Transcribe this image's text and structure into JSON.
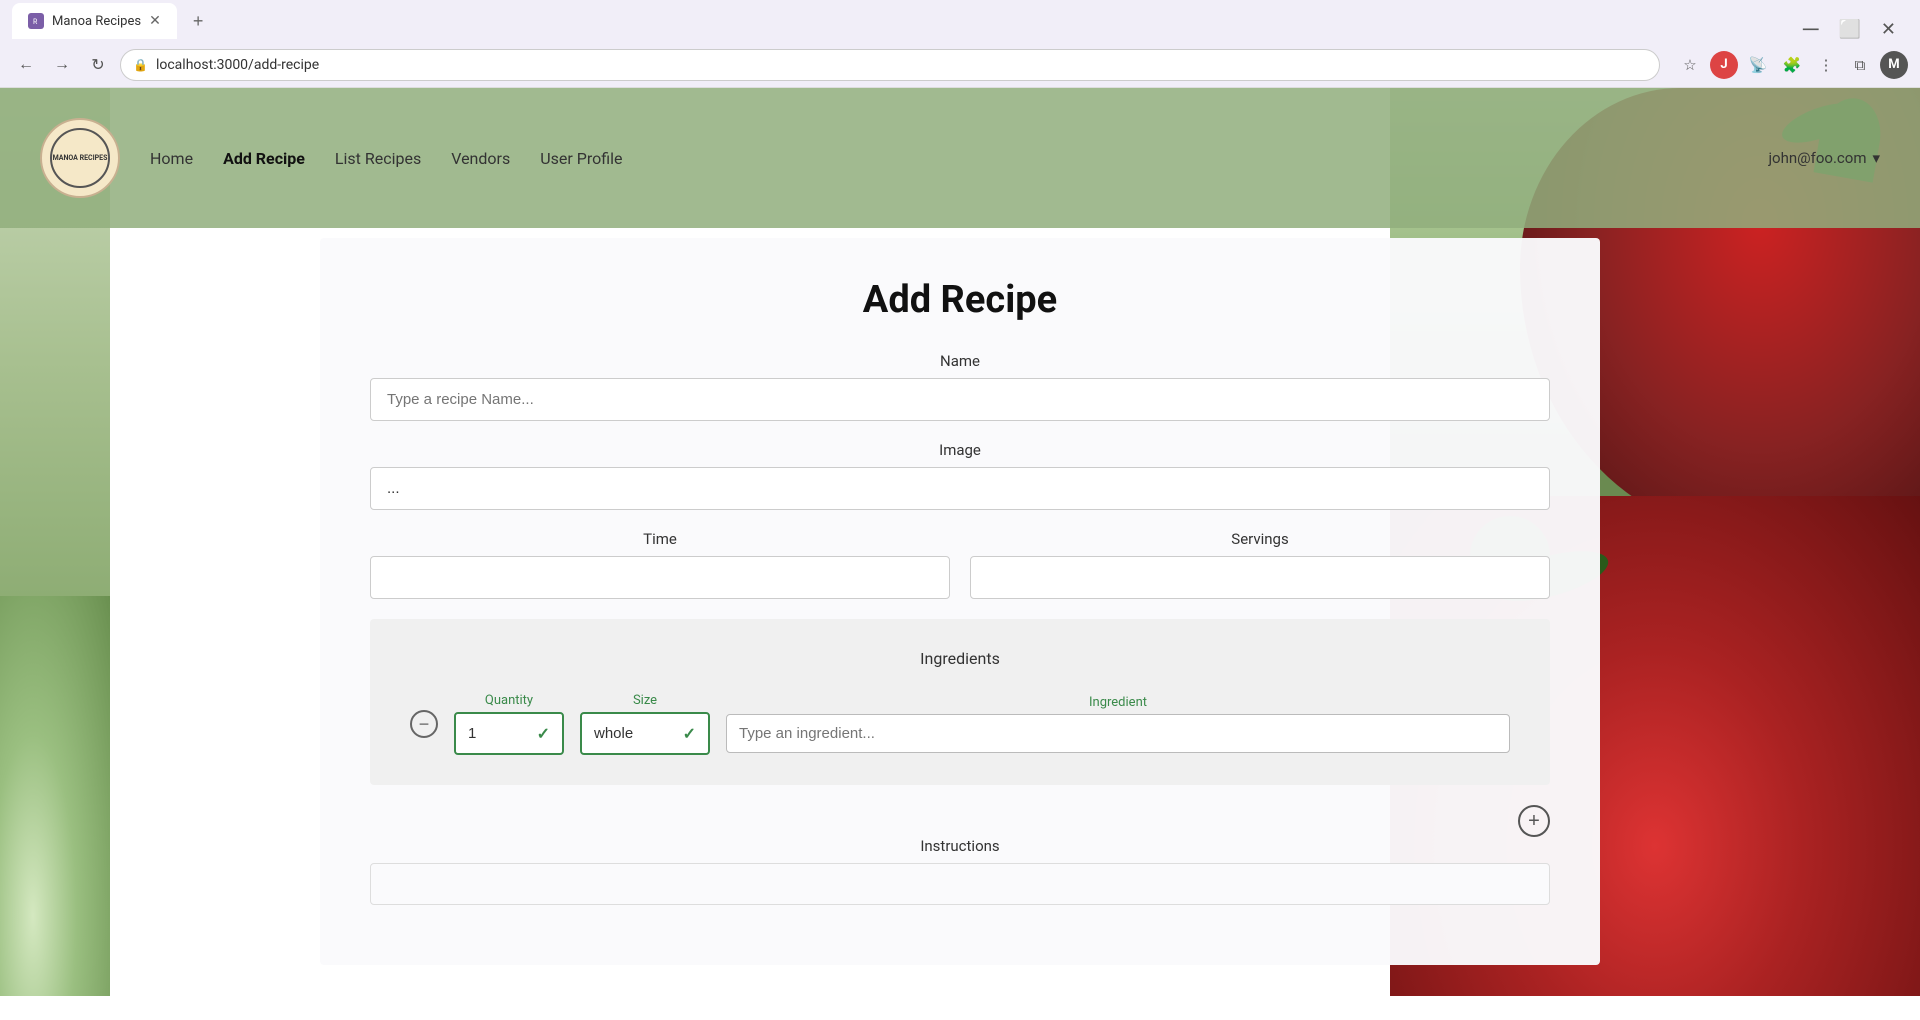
{
  "browser": {
    "tab_title": "Manoa Recipes",
    "url": "localhost:3000/add-recipe",
    "new_tab_label": "+"
  },
  "navbar": {
    "logo_text": "MANOA RECIPES",
    "links": [
      {
        "label": "Home",
        "active": false
      },
      {
        "label": "Add Recipe",
        "active": true
      },
      {
        "label": "List Recipes",
        "active": false
      },
      {
        "label": "Vendors",
        "active": false
      },
      {
        "label": "User Profile",
        "active": false
      }
    ],
    "user_email": "john@foo.com"
  },
  "page": {
    "title": "Add Recipe"
  },
  "form": {
    "name_label": "Name",
    "name_placeholder": "Type a recipe Name...",
    "image_label": "Image",
    "image_value": "...",
    "time_label": "Time",
    "servings_label": "Servings",
    "ingredients_title": "Ingredients",
    "quantity_label": "Quantity",
    "size_label": "Size",
    "ingredient_label": "Ingredient",
    "quantity_value": "1",
    "size_value": "whole",
    "ingredient_placeholder": "Type an ingredient...",
    "instructions_title": "Instructions"
  },
  "icons": {
    "back": "←",
    "forward": "→",
    "reload": "↻",
    "lock": "🔒",
    "star": "☆",
    "extensions": "🧩",
    "profile": "M",
    "remove": "−",
    "add": "+",
    "check": "✓",
    "dropdown": "▾",
    "close": "✕",
    "minimize": "−",
    "maximize": "□"
  }
}
